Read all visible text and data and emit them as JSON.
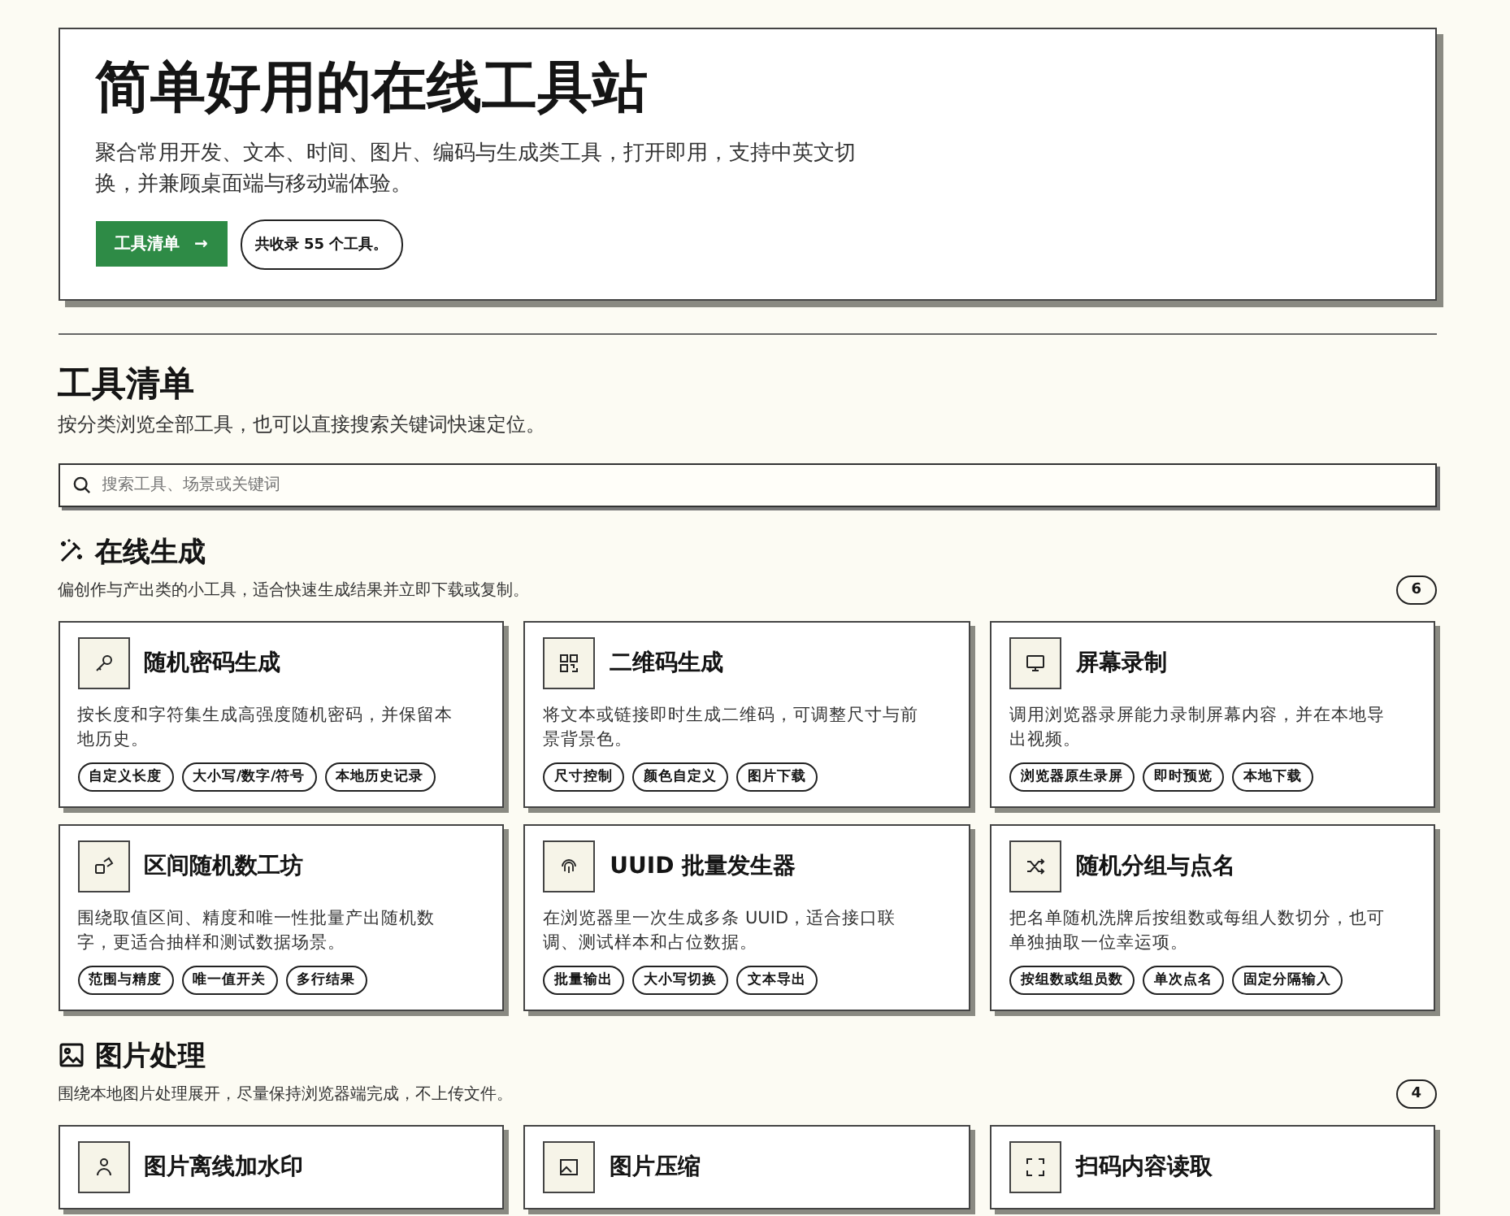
{
  "hero": {
    "title": "简单好用的在线工具站",
    "description": "聚合常用开发、文本、时间、图片、编码与生成类工具，打开即用，支持中英文切换，并兼顾桌面端与移动端体验。",
    "button": "工具清单",
    "arrow": "→",
    "count": "共收录 55 个工具。"
  },
  "catalog": {
    "title": "工具清单",
    "description": "按分类浏览全部工具，也可以直接搜索关键词快速定位。",
    "search": {
      "placeholder": "搜索工具、场景或关键词"
    }
  },
  "sections": [
    {
      "title": "在线生成",
      "description": "偏创作与产出类的小工具，适合快速生成结果并立即下载或复制。",
      "count": "6",
      "tools": [
        {
          "title": "随机密码生成",
          "description": "按长度和字符集生成高强度随机密码，并保留本地历史。",
          "tags": [
            "自定义长度",
            "大小写/数字/符号",
            "本地历史记录"
          ]
        },
        {
          "title": "二维码生成",
          "description": "将文本或链接即时生成二维码，可调整尺寸与前景背景色。",
          "tags": [
            "尺寸控制",
            "颜色自定义",
            "图片下载"
          ]
        },
        {
          "title": "屏幕录制",
          "description": "调用浏览器录屏能力录制屏幕内容，并在本地导出视频。",
          "tags": [
            "浏览器原生录屏",
            "即时预览",
            "本地下载"
          ]
        },
        {
          "title": "区间随机数工坊",
          "description": "围绕取值区间、精度和唯一性批量产出随机数字，更适合抽样和测试数据场景。",
          "tags": [
            "范围与精度",
            "唯一值开关",
            "多行结果"
          ]
        },
        {
          "title": "UUID 批量发生器",
          "description": "在浏览器里一次生成多条 UUID，适合接口联调、测试样本和占位数据。",
          "tags": [
            "批量输出",
            "大小写切换",
            "文本导出"
          ]
        },
        {
          "title": "随机分组与点名",
          "description": "把名单随机洗牌后按组数或每组人数切分，也可单独抽取一位幸运项。",
          "tags": [
            "按组数或组员数",
            "单次点名",
            "固定分隔输入"
          ]
        }
      ]
    },
    {
      "title": "图片处理",
      "description": "围绕本地图片处理展开，尽量保持浏览器端完成，不上传文件。",
      "count": "4",
      "tools": [
        {
          "title": "图片离线加水印"
        },
        {
          "title": "图片压缩"
        },
        {
          "title": "扫码内容读取"
        }
      ]
    }
  ]
}
